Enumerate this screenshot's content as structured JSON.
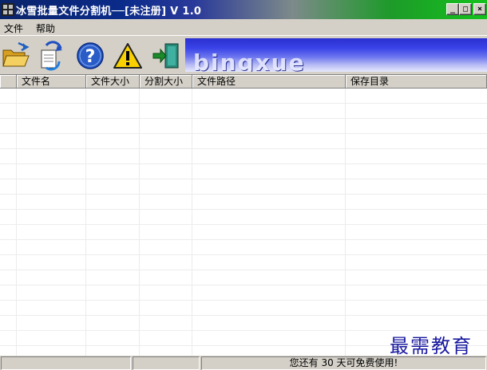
{
  "window": {
    "title": "冰雪批量文件分割机──[未注册]  V 1.0"
  },
  "caption_buttons": {
    "minimize": "_",
    "maximize": "□",
    "close": "×"
  },
  "menu": {
    "items": [
      "文件",
      "帮助"
    ]
  },
  "toolbar": {
    "buttons": [
      {
        "icon": "open-folder-icon"
      },
      {
        "icon": "refresh-icon"
      },
      {
        "icon": "help-icon"
      },
      {
        "icon": "warning-icon"
      },
      {
        "icon": "exit-icon"
      }
    ],
    "banner_text": "bingxue"
  },
  "list": {
    "columns": [
      "文件名",
      "文件大小",
      "分割大小",
      "文件路径",
      "保存目录"
    ]
  },
  "status": {
    "message": "您还有 30 天可免费使用!"
  },
  "watermark": "最需教育",
  "colors": {
    "title_left": "#0a246a",
    "title_right": "#14c21c",
    "banner": "#3a44e8",
    "watermark": "#1a1aa0"
  }
}
